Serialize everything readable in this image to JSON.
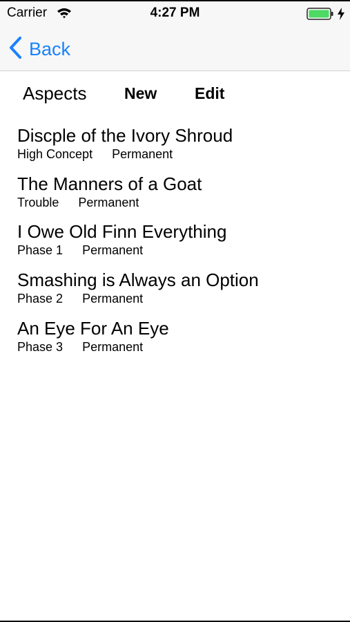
{
  "status_bar": {
    "carrier": "Carrier",
    "time": "4:27 PM",
    "icons": [
      "wifi-icon",
      "battery-icon",
      "charging-icon"
    ],
    "battery_color": "#4cd964"
  },
  "nav": {
    "back_label": "Back",
    "accent_color": "#1a82fb"
  },
  "toolbar": {
    "title": "Aspects",
    "new_label": "New",
    "edit_label": "Edit"
  },
  "aspects": [
    {
      "name": "Discple of the Ivory Shroud",
      "type": "High Concept",
      "duration": "Permanent"
    },
    {
      "name": "The Manners of a Goat",
      "type": "Trouble",
      "duration": "Permanent"
    },
    {
      "name": "I Owe Old Finn Everything",
      "type": "Phase 1",
      "duration": "Permanent"
    },
    {
      "name": "Smashing is Always an Option",
      "type": "Phase 2",
      "duration": "Permanent"
    },
    {
      "name": "An Eye For An Eye",
      "type": "Phase 3",
      "duration": "Permanent"
    }
  ]
}
